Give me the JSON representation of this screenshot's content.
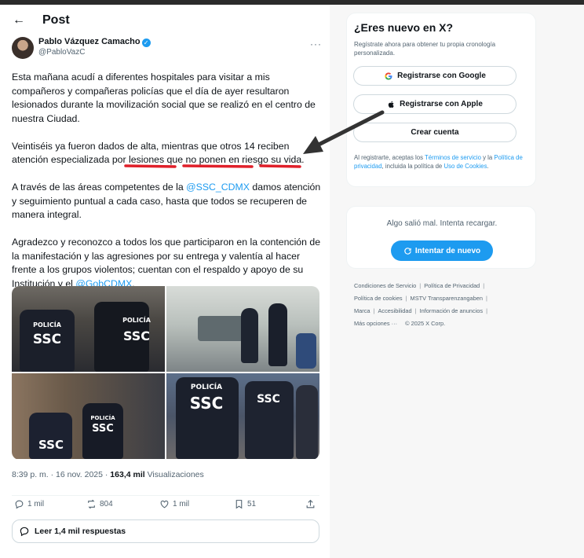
{
  "header": {
    "title": "Post"
  },
  "tweet": {
    "author_name": "Pablo Vázquez Camacho",
    "author_handle": "@PabloVazC",
    "p1": "Esta mañana acudí a diferentes hospitales para visitar a mis compañeros y compañeras policías que el día de ayer resultaron lesionados durante la movilización social que se realizó en el centro de nuestra Ciudad.",
    "p2": "Veintiséis ya fueron dados de alta, mientras que otros 14 reciben atención especializada por lesiones que no ponen en riesgo su vida.",
    "p3_before": "A través de las áreas competentes de la ",
    "p3_mention": "@SSC_CDMX",
    "p3_after": " damos atención y seguimiento puntual a cada caso, hasta que todos se recuperen de manera integral.",
    "p4_before": "Agradezco y reconozco a todos los que participaron en la contención de la manifestación y las agresiones por su entrega y valentía al hacer frente a los grupos violentos; cuentan con el respaldo y apoyo de su Institución y el ",
    "p4_mention": "@GobCDMX",
    "p4_after": ".",
    "photo_patches": {
      "policia": "POLICÍA",
      "ssc": "SSC"
    },
    "time_date": "8:39 p. m. · 16 nov. 2025 · ",
    "views_count": "163,4 mil",
    "views_label": " Visualizaciones",
    "replies": "1 mil",
    "reposts": "804",
    "likes": "1 mil",
    "bookmarks": "51",
    "read_replies": "Leer 1,4 mil respuestas"
  },
  "signup": {
    "title": "¿Eres nuevo en X?",
    "subtitle": "Regístrate ahora para obtener tu propia cronología personalizada.",
    "google_btn": "Registrarse con Google",
    "apple_btn": "Registrarse con Apple",
    "create_btn": "Crear cuenta",
    "legal_1": "Al registrarte, aceptas los ",
    "legal_terms": "Términos de servicio",
    "legal_2": " y la ",
    "legal_privacy": "Política de privacidad",
    "legal_3": ", incluida la política de ",
    "legal_cookies": "Uso de Cookies",
    "legal_4": "."
  },
  "error": {
    "message": "Algo salió mal. Intenta recargar.",
    "retry_btn": "Intentar de nuevo"
  },
  "footer": {
    "links": [
      "Condiciones de Servicio",
      "Política de Privacidad",
      "Política de cookies",
      "MSTV Transparenzangaben",
      "Marca",
      "Accesibilidad",
      "Información de anuncios",
      "Más opciones ···"
    ],
    "copyright": "© 2025 X Corp."
  },
  "colors": {
    "accent": "#1d9bf0",
    "annotation_red": "#e0202a",
    "annotation_arrow": "#333333"
  },
  "icons": [
    "back-arrow-icon",
    "verified-icon",
    "more-icon",
    "reply-icon",
    "repost-icon",
    "like-icon",
    "bookmark-icon",
    "share-icon",
    "google-icon",
    "apple-icon",
    "refresh-icon"
  ]
}
